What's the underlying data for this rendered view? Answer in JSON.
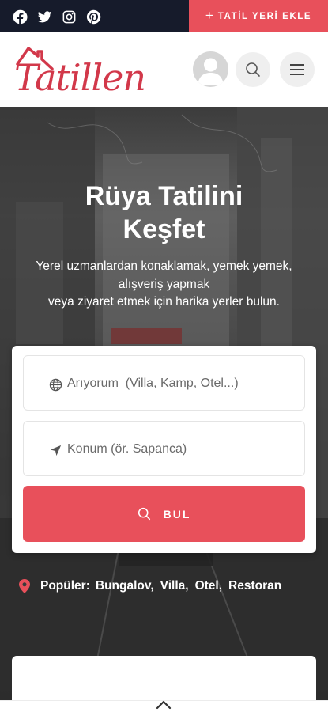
{
  "topbar": {
    "social_icons": [
      "facebook-icon",
      "twitter-icon",
      "instagram-icon",
      "pinterest-icon"
    ],
    "add_button_label": "TATİL YERİ EKLE",
    "add_button_icon": "plus-icon"
  },
  "header": {
    "logo_text": "Tatillen",
    "avatar_icon": "user-avatar-icon",
    "search_icon": "search-icon",
    "menu_icon": "hamburger-menu-icon"
  },
  "hero": {
    "title_line1": "Rüya Tatilini",
    "title_line2": "Keşfet",
    "subtitle_line1": "Yerel uzmanlardan konaklamak, yemek yemek,",
    "subtitle_line2": "alışveriş yapmak",
    "subtitle_line3": "veya ziyaret etmek için harika yerler bulun."
  },
  "search": {
    "keyword_placeholder": "Arıyorum  (Villa, Kamp, Otel...)",
    "keyword_value": "",
    "location_placeholder": "Konum (ör. Sapanca)",
    "location_value": "",
    "button_label": "BUL"
  },
  "popular": {
    "label": "Popüler:",
    "tags": [
      "Bungalov,",
      "Villa,",
      "Otel,",
      "Restoran"
    ]
  },
  "colors": {
    "accent": "#e8505b",
    "topbar_bg": "#161b2b",
    "logo_color": "#d2384a"
  }
}
